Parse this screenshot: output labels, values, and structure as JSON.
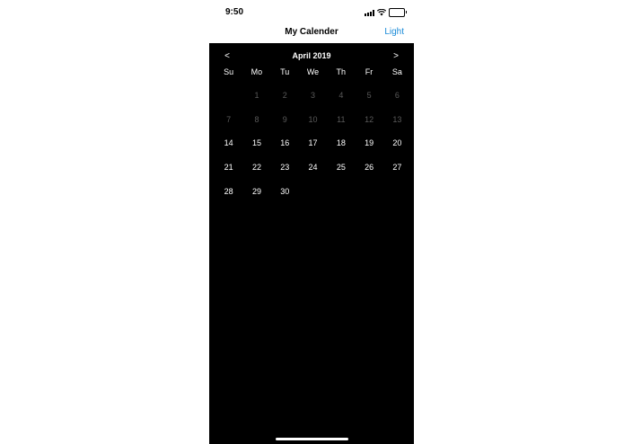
{
  "status_bar": {
    "time": "9:50",
    "icons": [
      "signal-icon",
      "wifi-icon",
      "battery-icon"
    ],
    "battery_color": "#35c759"
  },
  "nav": {
    "title": "My Calender",
    "action_label": "Light",
    "action_color": "#1a8bd8"
  },
  "calendar": {
    "prev_label": "<",
    "next_label": ">",
    "month_title": "April 2019",
    "weekdays": [
      "Su",
      "Mo",
      "Tu",
      "We",
      "Th",
      "Fr",
      "Sa"
    ],
    "leading_blanks": 1,
    "days": [
      {
        "n": "1",
        "dim": true
      },
      {
        "n": "2",
        "dim": true
      },
      {
        "n": "3",
        "dim": true
      },
      {
        "n": "4",
        "dim": true
      },
      {
        "n": "5",
        "dim": true
      },
      {
        "n": "6",
        "dim": true
      },
      {
        "n": "7",
        "dim": true
      },
      {
        "n": "8",
        "dim": true
      },
      {
        "n": "9",
        "dim": true
      },
      {
        "n": "10",
        "dim": true
      },
      {
        "n": "11",
        "dim": true
      },
      {
        "n": "12",
        "dim": true
      },
      {
        "n": "13",
        "dim": true
      },
      {
        "n": "14",
        "dim": false
      },
      {
        "n": "15",
        "dim": false
      },
      {
        "n": "16",
        "dim": false
      },
      {
        "n": "17",
        "dim": false
      },
      {
        "n": "18",
        "dim": false
      },
      {
        "n": "19",
        "dim": false
      },
      {
        "n": "20",
        "dim": false
      },
      {
        "n": "21",
        "dim": false
      },
      {
        "n": "22",
        "dim": false
      },
      {
        "n": "23",
        "dim": false
      },
      {
        "n": "24",
        "dim": false
      },
      {
        "n": "25",
        "dim": false
      },
      {
        "n": "26",
        "dim": false
      },
      {
        "n": "27",
        "dim": false
      },
      {
        "n": "28",
        "dim": false
      },
      {
        "n": "29",
        "dim": false
      },
      {
        "n": "30",
        "dim": false
      }
    ],
    "background": "#000000",
    "dim_color": "#5a5a5a"
  }
}
